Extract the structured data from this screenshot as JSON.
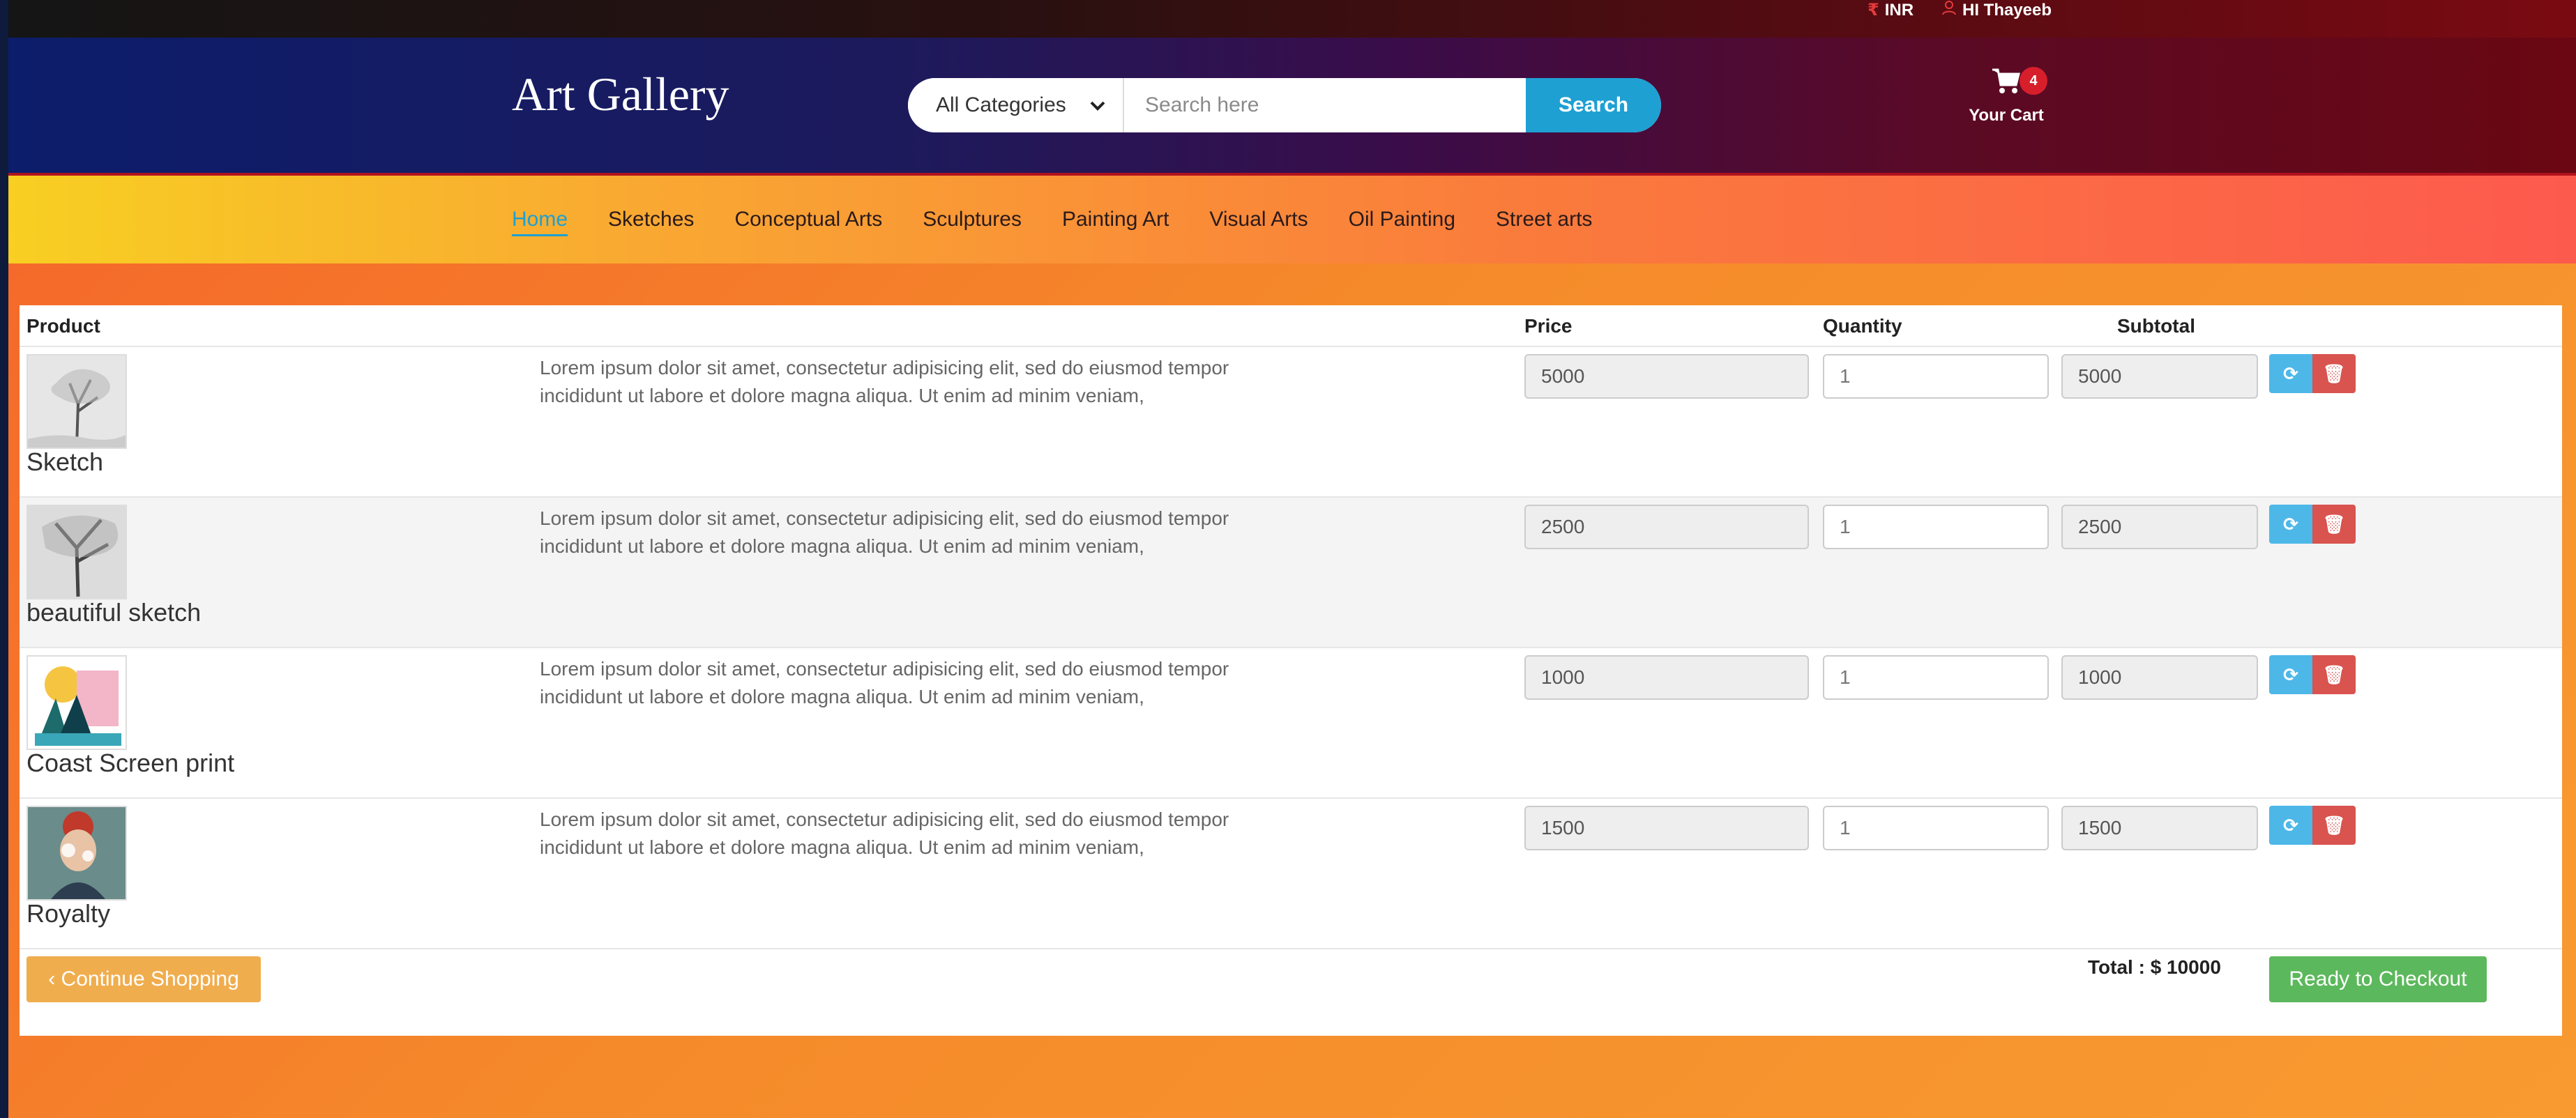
{
  "topbar": {
    "currency_icon": "rupee-icon",
    "currency": "INR",
    "user_icon": "user-icon",
    "greeting": "HI Thayeeb"
  },
  "header": {
    "brand": "Art Gallery",
    "search": {
      "category": "All Categories",
      "placeholder": "Search here",
      "button": "Search"
    },
    "cart": {
      "count": "4",
      "label": "Your Cart"
    }
  },
  "nav": {
    "items": [
      "Home",
      "Sketches",
      "Conceptual Arts",
      "Sculptures",
      "Painting Art",
      "Visual Arts",
      "Oil Painting",
      "Street arts"
    ],
    "active": "Home"
  },
  "table": {
    "headers": {
      "product": "Product",
      "price": "Price",
      "quantity": "Quantity",
      "subtotal": "Subtotal"
    },
    "rows": [
      {
        "name": "Sketch",
        "description": "Lorem ipsum dolor sit amet, consectetur adipisicing elit, sed do eiusmod tempor incididunt ut labore et dolore magna aliqua. Ut enim ad minim veniam,",
        "price": "5000",
        "quantity": "1",
        "subtotal": "5000"
      },
      {
        "name": "beautiful sketch",
        "description": "Lorem ipsum dolor sit amet, consectetur adipisicing elit, sed do eiusmod tempor incididunt ut labore et dolore magna aliqua. Ut enim ad minim veniam,",
        "price": "2500",
        "quantity": "1",
        "subtotal": "2500"
      },
      {
        "name": "Coast Screen print",
        "description": "Lorem ipsum dolor sit amet, consectetur adipisicing elit, sed do eiusmod tempor incididunt ut labore et dolore magna aliqua. Ut enim ad minim veniam,",
        "price": "1000",
        "quantity": "1",
        "subtotal": "1000"
      },
      {
        "name": "Royalty",
        "description": "Lorem ipsum dolor sit amet, consectetur adipisicing elit, sed do eiusmod tempor incididunt ut labore et dolore magna aliqua. Ut enim ad minim veniam,",
        "price": "1500",
        "quantity": "1",
        "subtotal": "1500"
      }
    ]
  },
  "footer": {
    "continue": "‹ Continue Shopping",
    "total": "Total : $ 10000",
    "checkout": "Ready to Checkout"
  },
  "colors": {
    "search_button": "#1ea0d3",
    "refresh_button": "#4db8e8",
    "remove_button": "#d9534f",
    "continue_button": "#f0ad4e",
    "checkout_button": "#5cb85c",
    "cart_badge": "#d71f2b"
  }
}
